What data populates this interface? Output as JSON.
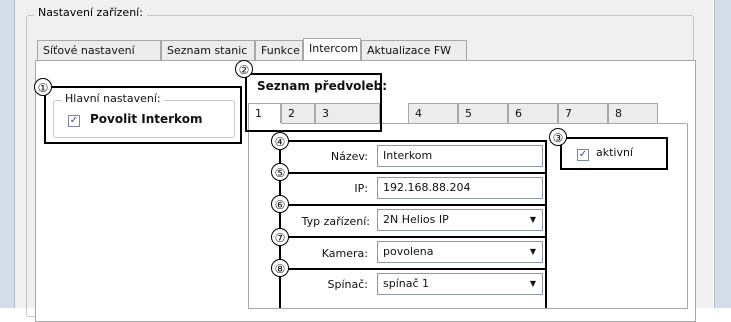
{
  "group_title": "Nastavení zařízení:",
  "tabs": [
    {
      "label": "Síťové nastavení"
    },
    {
      "label": "Seznam stanic"
    },
    {
      "label": "Funkce"
    },
    {
      "label": "Intercom"
    },
    {
      "label": "Aktualizace FW"
    }
  ],
  "active_tab": "Intercom",
  "main_settings": {
    "title": "Hlavní nastavení:",
    "enable_label": "Povolit Interkom",
    "enabled": true
  },
  "presets": {
    "title": "Seznam předvoleb:",
    "tabs": [
      "1",
      "2",
      "3",
      "4",
      "5",
      "6",
      "7",
      "8"
    ],
    "active": "1"
  },
  "active_checkbox": {
    "label": "aktivní",
    "checked": true
  },
  "fields": {
    "name_label": "Název:",
    "name_value": "Interkom",
    "ip_label": "IP:",
    "ip_value": "192.168.88.204",
    "device_type_label": "Typ zařízení:",
    "device_type_value": "2N Helios IP",
    "camera_label": "Kamera:",
    "camera_value": "povolena",
    "switch_label": "Spínač:",
    "switch_value": "spínač 1"
  },
  "markers": [
    "①",
    "②",
    "③",
    "④",
    "⑤",
    "⑥",
    "⑦",
    "⑧"
  ],
  "colors": {
    "frame": "#d3dce8",
    "panel": "#f0f0f0",
    "checkmark": "#2a4a9a"
  }
}
